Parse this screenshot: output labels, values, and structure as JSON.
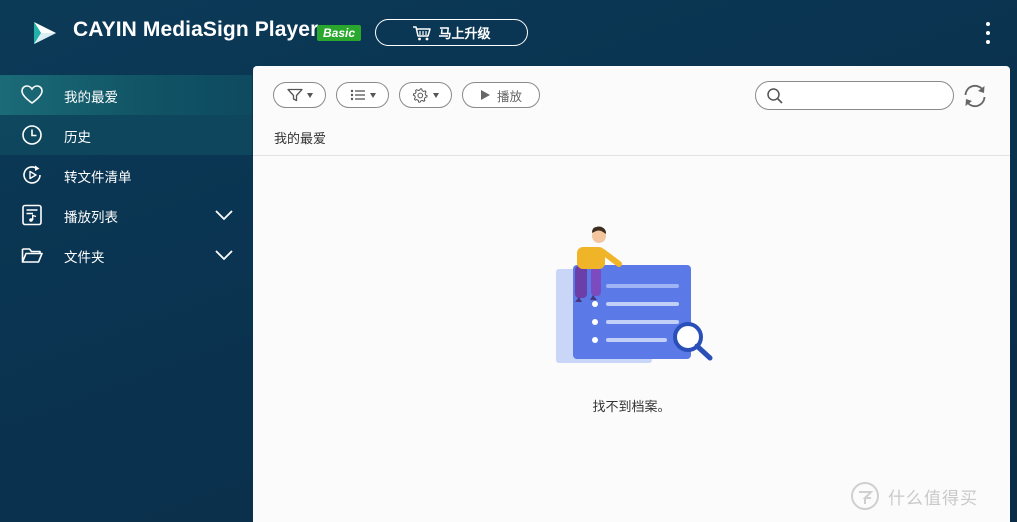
{
  "header": {
    "app_title": "CAYIN MediaSign Player",
    "edition_badge": "Basic",
    "upgrade_label": "马上升级",
    "icons": [
      "mediasign-logo-icon",
      "cart-icon",
      "more-vertical-icon"
    ]
  },
  "sidebar": {
    "items": [
      {
        "label": "我的最爱",
        "icon": "heart-icon",
        "active": true
      },
      {
        "label": "历史",
        "icon": "clock-icon"
      },
      {
        "label": "转文件清单",
        "icon": "transcode-icon"
      },
      {
        "label": "播放列表",
        "icon": "playlist-icon",
        "expandable": true
      },
      {
        "label": "文件夹",
        "icon": "folder-icon",
        "expandable": true
      }
    ]
  },
  "toolbar": {
    "filter_icon": "filter-icon",
    "list_icon": "list-view-icon",
    "settings_icon": "gear-icon",
    "play_label": "播放",
    "search_value": "",
    "search_icon": "search-icon",
    "refresh_icon": "refresh-icon"
  },
  "main": {
    "breadcrumb": "我的最爱",
    "empty_message": "找不到档案。"
  },
  "watermark": {
    "text": "什么值得买",
    "icon": "zhide-logo-icon"
  },
  "colors": {
    "background": "#0b3a57",
    "active_nav": "#1b6b78",
    "badge": "#2aa82e",
    "illustration_doc": "#5b7ae8",
    "illustration_back": "#c9d6f7"
  }
}
